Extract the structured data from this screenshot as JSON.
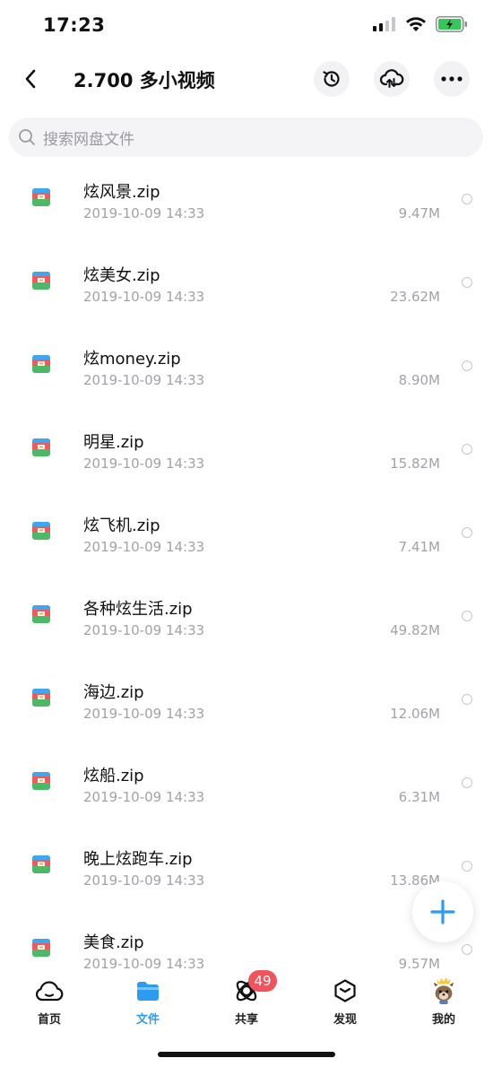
{
  "status": {
    "time": "17:23"
  },
  "header": {
    "title": "2.700 多小视频"
  },
  "search": {
    "placeholder": "搜索网盘文件"
  },
  "files": [
    {
      "name": "炫风景.zip",
      "date": "2019-10-09 14:33",
      "size": "9.47M"
    },
    {
      "name": "炫美女.zip",
      "date": "2019-10-09 14:33",
      "size": "23.62M"
    },
    {
      "name": "炫money.zip",
      "date": "2019-10-09 14:33",
      "size": "8.90M"
    },
    {
      "name": "明星.zip",
      "date": "2019-10-09 14:33",
      "size": "15.82M"
    },
    {
      "name": "炫飞机.zip",
      "date": "2019-10-09 14:33",
      "size": "7.41M"
    },
    {
      "name": "各种炫生活.zip",
      "date": "2019-10-09 14:33",
      "size": "49.82M"
    },
    {
      "name": "海边.zip",
      "date": "2019-10-09 14:33",
      "size": "12.06M"
    },
    {
      "name": "炫船.zip",
      "date": "2019-10-09 14:33",
      "size": "6.31M"
    },
    {
      "name": "晚上炫跑车.zip",
      "date": "2019-10-09 14:33",
      "size": "13.86M"
    },
    {
      "name": "美食.zip",
      "date": "2019-10-09 14:33",
      "size": "9.57M"
    }
  ],
  "tabs": [
    {
      "label": "首页",
      "icon": "home-cloud-icon"
    },
    {
      "label": "文件",
      "icon": "folder-icon"
    },
    {
      "label": "共享",
      "icon": "share-orbit-icon",
      "badge": "49"
    },
    {
      "label": "发现",
      "icon": "discover-cube-icon"
    },
    {
      "label": "我的",
      "icon": "avatar-icon"
    }
  ],
  "colors": {
    "accent": "#2b9cf2",
    "badge": "#f2525a",
    "muted_text": "#a2a2a8"
  }
}
